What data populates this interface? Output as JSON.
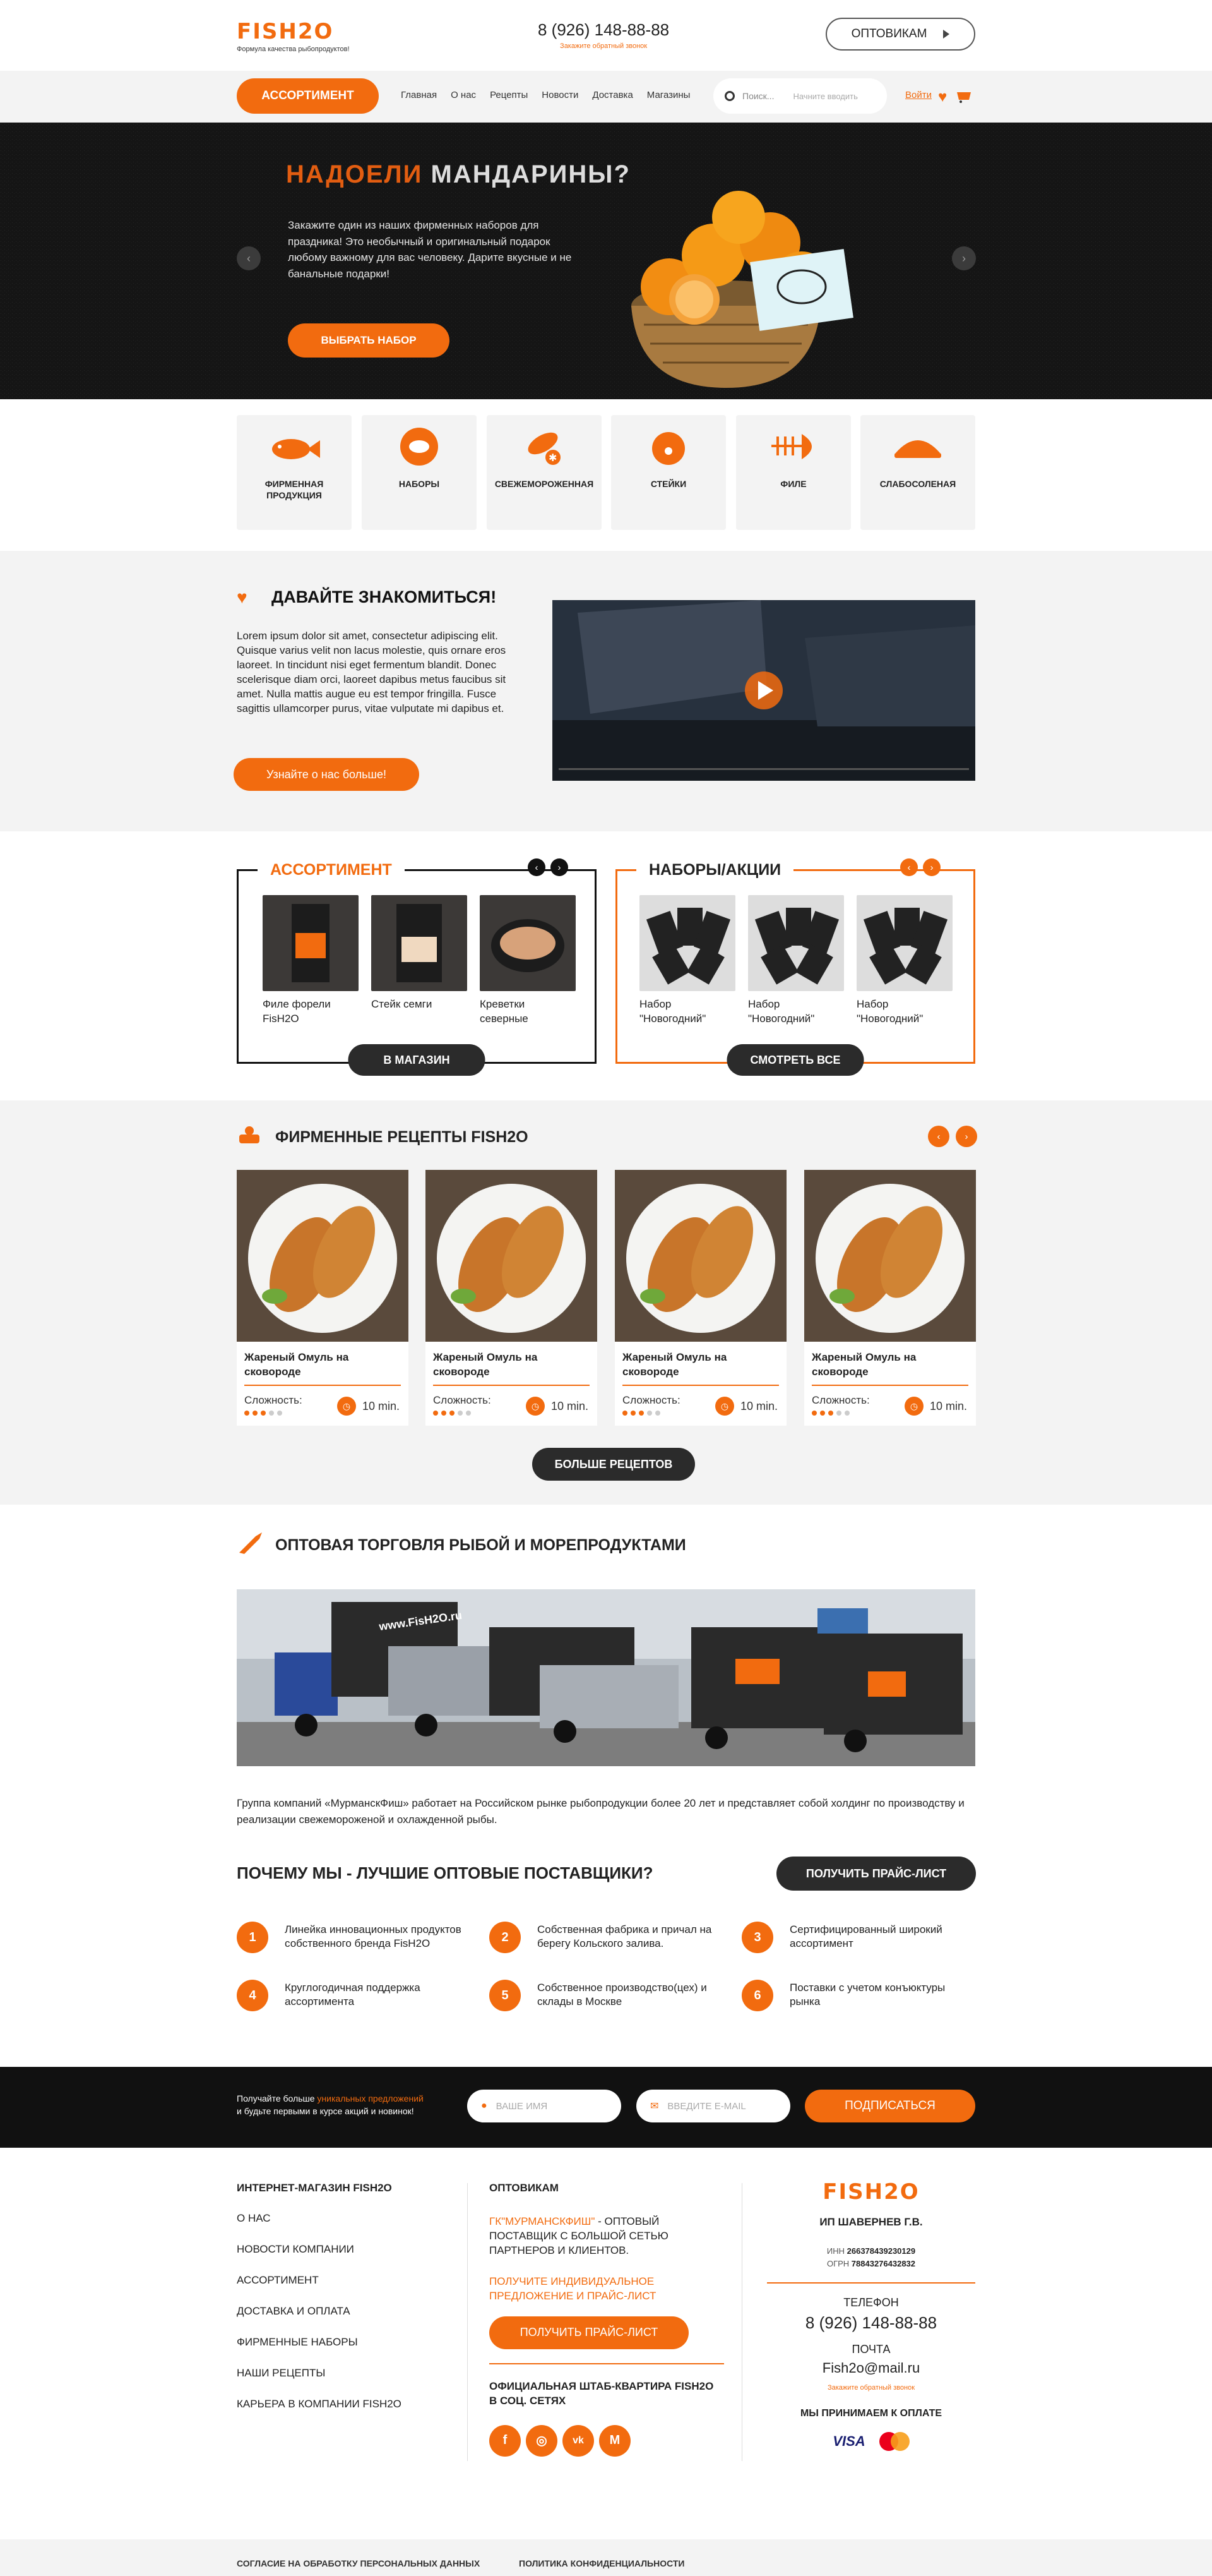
{
  "header": {
    "logo": "FISH2O",
    "tagline": "Формула качества рыбопродуктов!",
    "phone": "8 (926) 148-88-88",
    "callback": "Закажите обратный звонок",
    "wholesale_btn": "ОПТОВИКАМ"
  },
  "nav": {
    "assortment_btn": "АССОРТИМЕНТ",
    "menu": [
      "Главная",
      "О нас",
      "Рецепты",
      "Новости",
      "Доставка",
      "Магазины"
    ],
    "search_label": "Поиск...",
    "search_hint": "Начните вводить",
    "login": "Войти"
  },
  "hero": {
    "title_a": "НАДОЕЛИ",
    "title_b": "МАНДАРИНЫ?",
    "desc": "Закажите один из наших фирменных наборов для праздника! Это необычный и оригинальный подарок любому важному для вас человеку. Дарите вкусные и не банальные подарки!",
    "button": "ВЫБРАТЬ НАБОР"
  },
  "categories": [
    "ФИРМЕННАЯ ПРОДУКЦИЯ",
    "НАБОРЫ",
    "СВЕЖЕМОРОЖЕННАЯ",
    "СТЕЙКИ",
    "ФИЛЕ",
    "СЛАБОСОЛЕНАЯ"
  ],
  "about": {
    "title": "ДАВАЙТЕ ЗНАКОМИТЬСЯ!",
    "text": "Lorem ipsum dolor sit amet, consectetur adipiscing elit. Quisque varius velit non lacus molestie, quis ornare eros laoreet. In tincidunt nisi eget fermentum blandit. Donec scelerisque diam orci, laoreet dapibus metus faucibus sit amet. Nulla mattis augue eu est tempor fringilla. Fusce sagittis ullamcorper purus, vitae vulputate mi dapibus et.",
    "button": "Узнайте о нас больше!"
  },
  "assortment": {
    "title": "АССОРТИМЕНТ",
    "items": [
      "Филе форели FisH2O",
      "Стейк семги",
      "Креветки северные"
    ],
    "button": "В МАГАЗИН"
  },
  "sets": {
    "title": "НАБОРЫ/АКЦИИ",
    "items": [
      "Набор \"Новогодний\"",
      "Набор \"Новогодний\"",
      "Набор \"Новогодний\""
    ],
    "button": "СМОТРЕТЬ ВСЕ"
  },
  "recipes": {
    "title": "ФИРМЕННЫЕ РЕЦЕПТЫ FISH2O",
    "difficulty_label": "Сложность:",
    "items": [
      {
        "name": "Жареный Омуль на сковороде",
        "time": "10 min."
      },
      {
        "name": "Жареный Омуль на сковороде",
        "time": "10 min."
      },
      {
        "name": "Жареный Омуль на сковороде",
        "time": "10 min."
      },
      {
        "name": "Жареный Омуль на сковороде",
        "time": "10 min."
      }
    ],
    "difficulty": 3,
    "button": "БОЛЬШЕ РЕЦЕПТОВ"
  },
  "wholesale": {
    "title": "ОПТОВАЯ ТОРГОВЛЯ РЫБОЙ И МОРЕПРОДУКТАМИ",
    "truck_text": "www.FisH2O.ru",
    "text": "Группа компаний «МурманскФиш» работает на Российском рынке рыбопродукции более 20 лет и представляет собой холдинг по производству и реализации свежемороженой и охлажденной рыбы.",
    "why_title": "ПОЧЕМУ МЫ - ЛУЧШИЕ ОПТОВЫЕ ПОСТАВЩИКИ?",
    "price_btn": "ПОЛУЧИТЬ ПРАЙС-ЛИСТ",
    "reasons": [
      "Линейка инновационных продуктов собственного бренда FisH2O",
      "Собственная фабрика и причал на берегу Кольского залива.",
      "Сертифицированный широкий ассортимент",
      "Круглогодичная поддержка ассортимента",
      "Собственное производство(цех) и склады в Москве",
      "Поставки с учетом конъюктуры рынка"
    ]
  },
  "subscribe": {
    "text_a": "Получайте больше ",
    "text_hl": "уникальных предложений",
    "text_b": "и будьте первыми в курсе акций и новинок!",
    "name_ph": "ВАШЕ ИМЯ",
    "email_ph": "ВВЕДИТЕ E-MAIL",
    "button": "ПОДПИСАТЬСЯ"
  },
  "footer": {
    "col1_title": "ИНТЕРНЕТ-МАГАЗИН FISH2O",
    "links": [
      "О НАС",
      "НОВОСТИ КОМПАНИИ",
      "АССОРТИМЕНТ",
      "ДОСТАВКА И ОПЛАТА",
      "ФИРМЕННЫЕ НАБОРЫ",
      "НАШИ РЕЦЕПТЫ",
      "КАРЬЕРА В КОМПАНИИ FISH2O"
    ],
    "col2_title": "ОПТОВИКАМ",
    "company_hl": "ГК\"МУРМАНСКФИШ\"",
    "company_rest": " - ОПТОВЫЙ ПОСТАВЩИК С БОЛЬШОЙ СЕТЬЮ ПАРТНЕРОВ И КЛИЕНТОВ.",
    "offer": "ПОЛУЧИТЕ ИНДИВИДУАЛЬНОЕ ПРЕДЛОЖЕНИЕ И ПРАЙС-ЛИСТ",
    "price_btn": "ПОЛУЧИТЬ ПРАЙС-ЛИСТ",
    "social_title": "ОФИЦИАЛЬНАЯ ШТАБ-КВАРТИРА FISH2O В СОЦ. СЕТЯХ",
    "owner": "ИП ШАВЕРНЕВ Г.В.",
    "inn_label": "ИНН",
    "inn": "266378439230129",
    "ogrn_label": "ОГРН",
    "ogrn": "78843276432832",
    "phone_label": "ТЕЛЕФОН",
    "phone": "8 (926) 148-88-88",
    "mail_label": "ПОЧТА",
    "mail": "Fish2o@mail.ru",
    "callback": "Закажите обратный звонок",
    "pay_title": "МЫ ПРИНИМАЕМ К ОПЛАТЕ",
    "visa": "VISA"
  },
  "bottom": {
    "consent": "СОГЛАСИЕ НА ОБРАБОТКУ ПЕРСОНАЛЬНЫХ ДАННЫХ",
    "privacy": "ПОЛИТИКА КОНФИДЕНЦИАЛЬНОСТИ"
  },
  "colors": {
    "accent": "#f26b0f",
    "dark": "#2b2b2b",
    "light": "#f3f3f3"
  }
}
